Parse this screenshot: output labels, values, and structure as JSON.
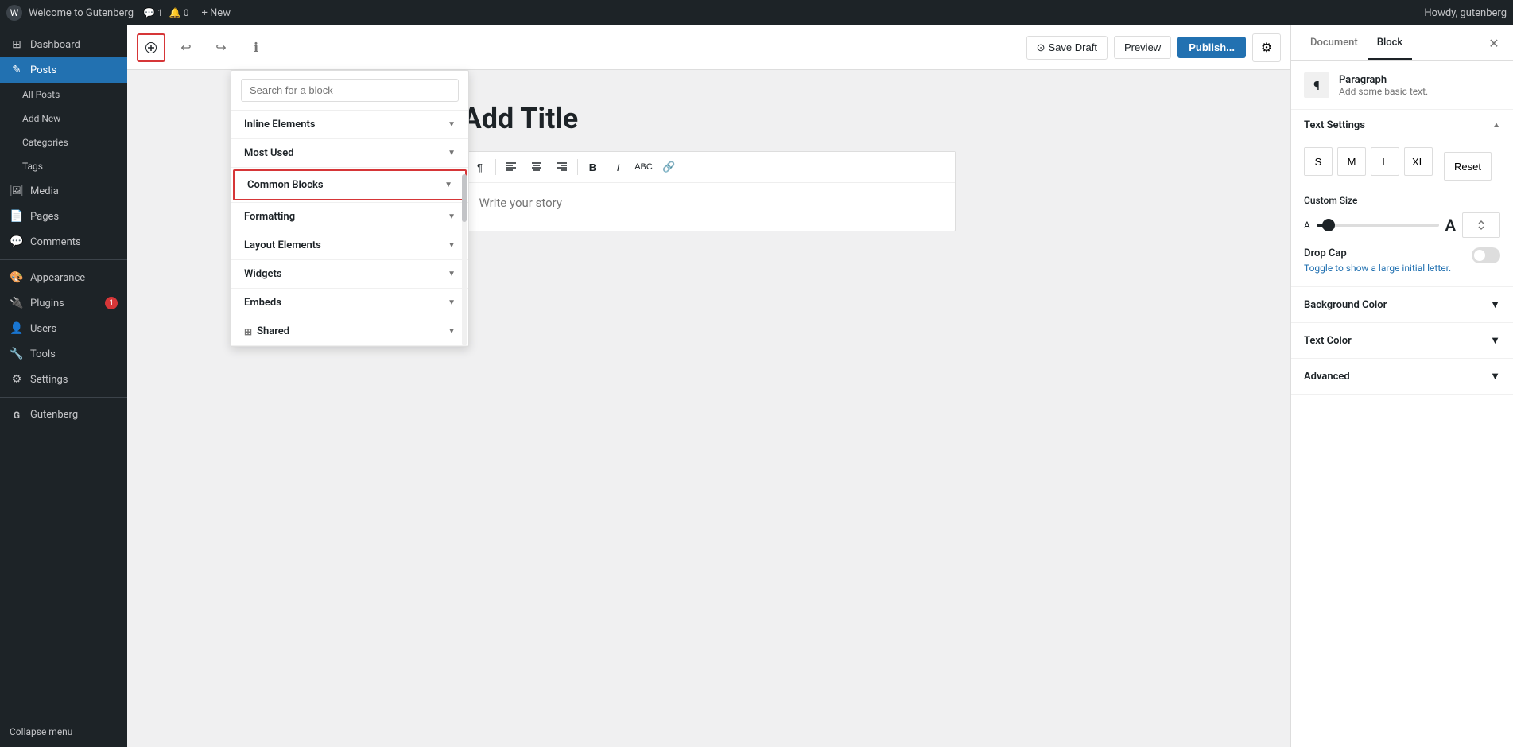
{
  "topbar": {
    "wp_logo": "W",
    "site_name": "Welcome to Gutenberg",
    "icon_comments_count": "1",
    "icon_notifications_count": "0",
    "new_label": "+ New",
    "howdy": "Howdy, gutenberg"
  },
  "sidebar": {
    "items": [
      {
        "id": "dashboard",
        "icon": "⊞",
        "label": "Dashboard"
      },
      {
        "id": "posts",
        "icon": "📝",
        "label": "Posts",
        "active": true
      },
      {
        "id": "all-posts",
        "icon": "",
        "label": "All Posts",
        "sub": true
      },
      {
        "id": "add-new",
        "icon": "",
        "label": "Add New",
        "sub": true
      },
      {
        "id": "categories",
        "icon": "",
        "label": "Categories",
        "sub": true
      },
      {
        "id": "tags",
        "icon": "",
        "label": "Tags",
        "sub": true
      },
      {
        "id": "media",
        "icon": "🖼",
        "label": "Media"
      },
      {
        "id": "pages",
        "icon": "📄",
        "label": "Pages"
      },
      {
        "id": "comments",
        "icon": "💬",
        "label": "Comments"
      },
      {
        "id": "appearance",
        "icon": "🎨",
        "label": "Appearance"
      },
      {
        "id": "plugins",
        "icon": "🔌",
        "label": "Plugins",
        "badge": "1"
      },
      {
        "id": "users",
        "icon": "👤",
        "label": "Users"
      },
      {
        "id": "tools",
        "icon": "🔧",
        "label": "Tools"
      },
      {
        "id": "settings",
        "icon": "⚙",
        "label": "Settings"
      },
      {
        "id": "gutenberg",
        "icon": "G",
        "label": "Gutenberg"
      }
    ],
    "collapse_label": "Collapse menu"
  },
  "editor_topbar": {
    "add_block_tooltip": "+",
    "undo_icon": "↩",
    "redo_icon": "↪",
    "info_icon": "ℹ",
    "save_draft_label": "Save Draft",
    "preview_label": "Preview",
    "publish_label": "Publish...",
    "settings_icon": "⚙"
  },
  "block_inserter": {
    "search_placeholder": "Search for a block",
    "categories": [
      {
        "id": "inline-elements",
        "label": "Inline Elements",
        "highlighted": false
      },
      {
        "id": "most-used",
        "label": "Most Used",
        "highlighted": false
      },
      {
        "id": "common-blocks",
        "label": "Common Blocks",
        "highlighted": true
      },
      {
        "id": "formatting",
        "label": "Formatting",
        "highlighted": false
      },
      {
        "id": "layout-elements",
        "label": "Layout Elements",
        "highlighted": false
      },
      {
        "id": "widgets",
        "label": "Widgets",
        "highlighted": false
      },
      {
        "id": "embeds",
        "label": "Embeds",
        "highlighted": false
      },
      {
        "id": "shared",
        "label": "Shared",
        "icon": "🔗",
        "highlighted": false
      }
    ]
  },
  "post": {
    "title_placeholder": "Add Title",
    "content_placeholder": "Write your story",
    "toolbar_buttons": [
      {
        "id": "paragraph",
        "icon": "¶",
        "title": "Paragraph"
      },
      {
        "id": "align-left",
        "icon": "≡",
        "title": "Align Left"
      },
      {
        "id": "align-center",
        "icon": "≡",
        "title": "Align Center"
      },
      {
        "id": "align-right",
        "icon": "≡",
        "title": "Align Right"
      },
      {
        "id": "bold",
        "icon": "B",
        "title": "Bold"
      },
      {
        "id": "italic",
        "icon": "I",
        "title": "Italic"
      },
      {
        "id": "strikethrough",
        "icon": "S̶",
        "title": "Strikethrough"
      },
      {
        "id": "link",
        "icon": "🔗",
        "title": "Link"
      }
    ]
  },
  "right_panel": {
    "tab_document": "Document",
    "tab_block": "Block",
    "active_tab": "Block",
    "block_name": "Paragraph",
    "block_description": "Add some basic text.",
    "text_settings": {
      "label": "Text Settings",
      "size_buttons": [
        "S",
        "M",
        "L",
        "XL"
      ],
      "reset_label": "Reset",
      "custom_size_label": "Custom Size",
      "drop_cap_label": "Drop Cap",
      "drop_cap_desc": "Toggle to show a large initial letter."
    },
    "background_color_label": "Background Color",
    "text_color_label": "Text Color",
    "advanced_label": "Advanced"
  }
}
